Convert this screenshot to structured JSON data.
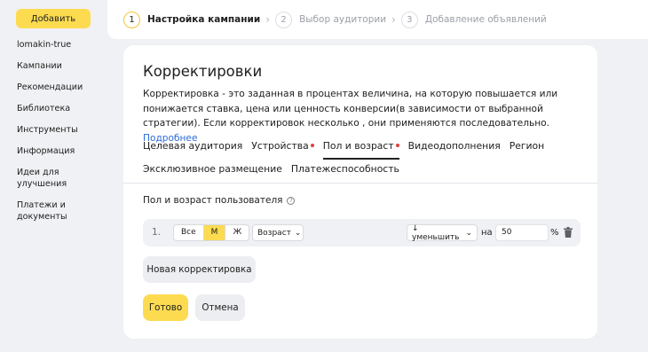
{
  "sidebar": {
    "add_label": "Добавить",
    "items": [
      {
        "label": "lomakin-true"
      },
      {
        "label": "Кампании"
      },
      {
        "label": "Рекомендации"
      },
      {
        "label": "Библиотека"
      },
      {
        "label": "Инструменты"
      },
      {
        "label": "Информация"
      },
      {
        "label": "Идеи для улучшения"
      },
      {
        "label": "Платежи и документы"
      }
    ]
  },
  "steps": [
    {
      "num": "1",
      "label": "Настройка кампании"
    },
    {
      "num": "2",
      "label": "Выбор аудитории"
    },
    {
      "num": "3",
      "label": "Добавление объявлений"
    }
  ],
  "card": {
    "title": "Корректировки",
    "description": "Корректировка - это заданная в процентах величина, на которую повышается или понижается ставка, цена или ценность конверсии(в зависимости от выбранной стратегии). Если корректировок несколько , они применяются последовательно.",
    "more_link": "Подробнее",
    "tabs_row1": [
      {
        "label": "Целевая аудитория"
      },
      {
        "label": "Устройства"
      },
      {
        "label": "Пол и возраст"
      },
      {
        "label": "Видеодополнения"
      },
      {
        "label": "Регион"
      }
    ],
    "tabs_row2": [
      {
        "label": "Эксклюзивное размещение"
      },
      {
        "label": "Платежеспособность"
      }
    ],
    "section_label": "Пол и возраст пользователя",
    "help_glyph": "?",
    "row": {
      "index": "1.",
      "gender_options": [
        "Все",
        "М",
        "Ж"
      ],
      "gender_selected": "М",
      "age_label": "Возраст",
      "direction_label": "↓ уменьшить",
      "on_label": "на",
      "value": "50",
      "percent_sign": "%"
    },
    "new_button": "Новая корректировка",
    "done_button": "Готово",
    "cancel_button": "Отмена"
  },
  "colors": {
    "accent": "#fddb51",
    "link": "#2a6bd9",
    "dot": "#e04040"
  }
}
